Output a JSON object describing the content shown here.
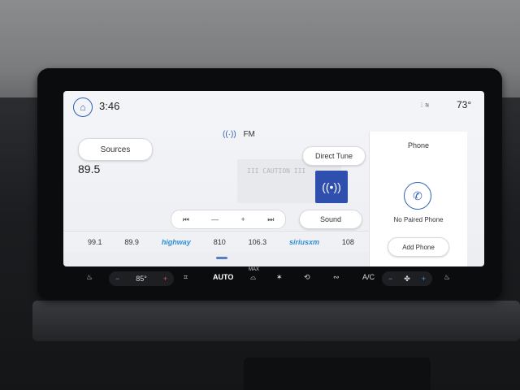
{
  "status": {
    "time": "3:46",
    "outside_temp": "73°"
  },
  "radio": {
    "band": "FM",
    "sources_label": "Sources",
    "frequency": "89.5",
    "direct_tune_label": "Direct Tune",
    "sound_label": "Sound",
    "art_text": "III CAUTION III",
    "presets": [
      "99.1",
      "89.9",
      "highway",
      "810",
      "106.3",
      "siriusxm",
      "108"
    ]
  },
  "phone": {
    "title": "Phone",
    "status": "No Paired Phone",
    "add_label": "Add Phone"
  },
  "climate": {
    "driver_temp": "85°",
    "auto_label": "AUTO",
    "max_label": "MAX",
    "ac_label": "A/C",
    "minus": "−",
    "plus": "+"
  },
  "colors": {
    "accent": "#2f5fb6",
    "tile": "#2e4fae"
  }
}
